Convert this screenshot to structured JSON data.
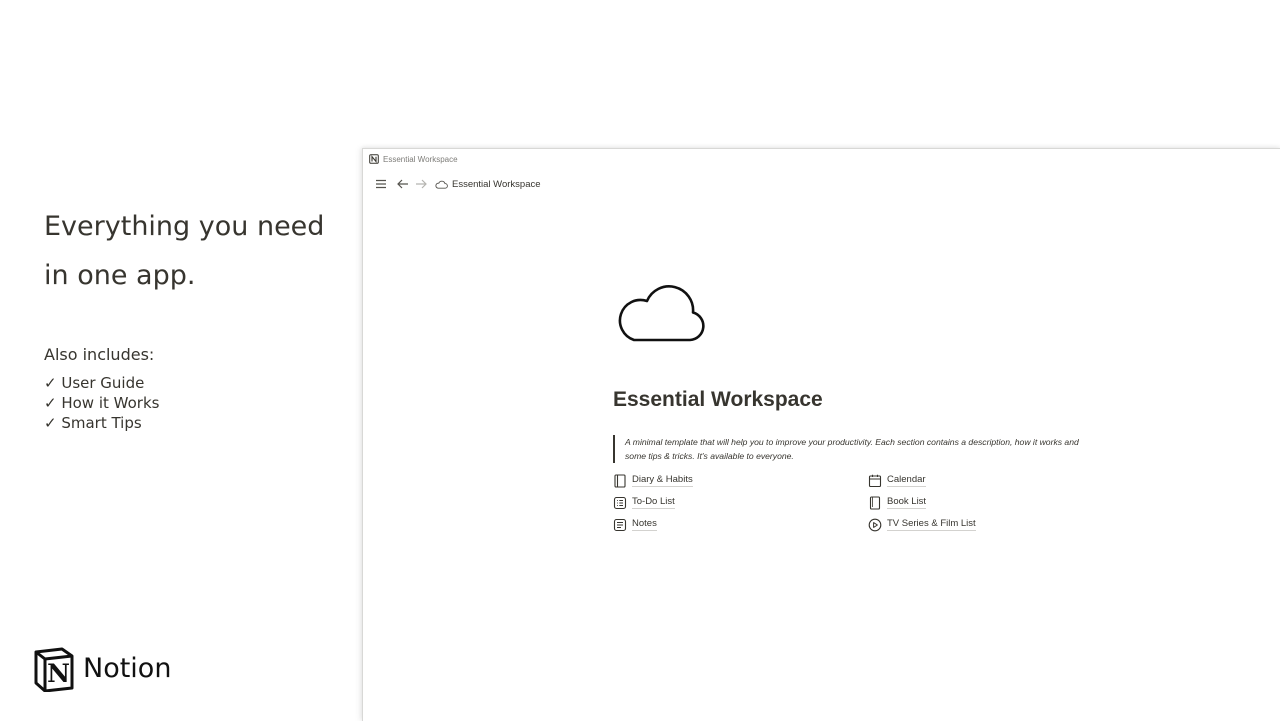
{
  "promo": {
    "headline_line1": "Everything you need",
    "headline_line2": "in one app.",
    "includes_title": "Also includes:",
    "includes": [
      "✓ User Guide",
      "✓ How it Works",
      "✓ Smart Tips"
    ],
    "brand_logo_letter": "N",
    "brand_name": "Notion"
  },
  "window": {
    "title": "Essential Workspace",
    "app_icon": "notion-icon"
  },
  "topbar": {
    "menu_icon": "hamburger-icon",
    "back_icon": "arrow-left-icon",
    "forward_icon": "arrow-right-icon",
    "breadcrumb_icon": "cloud-icon",
    "breadcrumb": "Essential Workspace"
  },
  "page": {
    "icon": "cloud-icon",
    "title": "Essential Workspace",
    "description": "A minimal template that will help you to improve your productivity. Each section contains a description, how it works and some tips & tricks. It's available to everyone.",
    "links": [
      {
        "label": "Diary & Habits",
        "icon": "notebook-icon"
      },
      {
        "label": "Calendar",
        "icon": "calendar-icon"
      },
      {
        "label": "To-Do List",
        "icon": "checklist-icon"
      },
      {
        "label": "Book List",
        "icon": "book-icon"
      },
      {
        "label": "Notes",
        "icon": "note-icon"
      },
      {
        "label": "TV Series & Film List",
        "icon": "play-circle-icon"
      }
    ]
  },
  "colors": {
    "text": "#37352f",
    "muted": "#7d7c78",
    "background": "#ffffff"
  }
}
